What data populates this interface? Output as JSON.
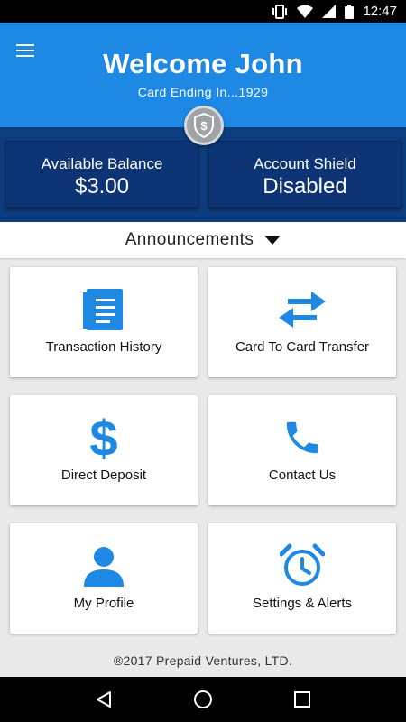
{
  "status_bar": {
    "time": "12:47"
  },
  "header": {
    "title": "Welcome John",
    "subtitle": "Card Ending In...1929"
  },
  "balances": {
    "available_label": "Available Balance",
    "available_value": "$3.00",
    "shield_label": "Account Shield",
    "shield_value": "Disabled"
  },
  "announcements": {
    "label": "Announcements"
  },
  "tiles": [
    {
      "label": "Transaction History",
      "icon": "document-icon"
    },
    {
      "label": "Card To Card Transfer",
      "icon": "transfer-arrows-icon"
    },
    {
      "label": "Direct Deposit",
      "icon": "dollar-icon"
    },
    {
      "label": "Contact Us",
      "icon": "phone-icon"
    },
    {
      "label": "My Profile",
      "icon": "person-icon"
    },
    {
      "label": "Settings & Alerts",
      "icon": "alarm-clock-icon"
    }
  ],
  "footer": {
    "copyright": "®2017 Prepaid Ventures, LTD."
  },
  "colors": {
    "header_blue": "#1e88e5",
    "dark_blue": "#0d3d7e",
    "icon_blue": "#1e88e5"
  }
}
